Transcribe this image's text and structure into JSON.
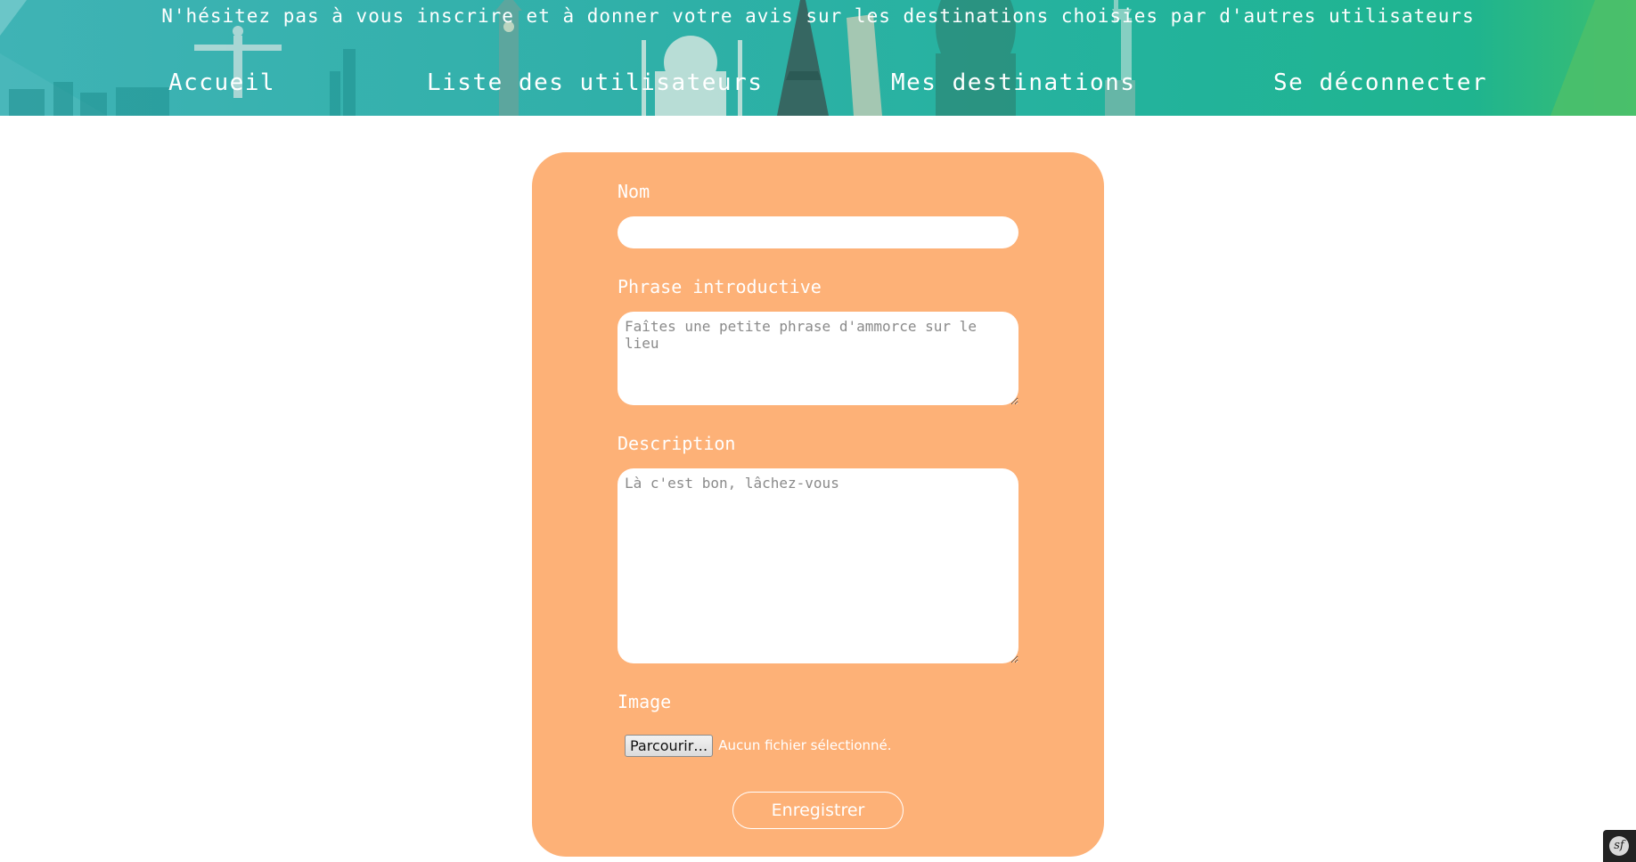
{
  "header": {
    "tagline": "N'hésitez pas à vous inscrire et à donner votre avis sur les destinations choisies par d'autres utilisateurs",
    "nav": [
      {
        "label": "Accueil"
      },
      {
        "label": "Liste des utilisateurs"
      },
      {
        "label": "Mes destinations"
      },
      {
        "label": "Se déconnecter"
      }
    ]
  },
  "form": {
    "name_label": "Nom",
    "name_value": "",
    "intro_label": "Phrase introductive",
    "intro_placeholder": "Faîtes une petite phrase d'ammorce sur le lieu",
    "description_label": "Description",
    "description_placeholder": "Là c'est bon, lâchez-vous",
    "image_label": "Image",
    "browse_label": "Parcourir…",
    "no_file_text": "Aucun fichier sélectionné.",
    "submit_label": "Enregistrer"
  },
  "toolbar": {
    "logo_text": "sf"
  },
  "colors": {
    "card_background": "#fdb177",
    "banner_teal": "#2fb0a8",
    "banner_green": "#3cbf6e"
  }
}
